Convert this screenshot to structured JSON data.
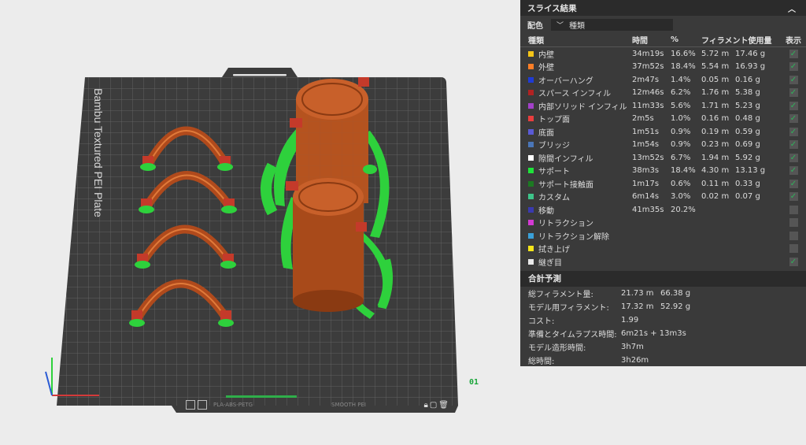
{
  "viewport": {
    "plate_name": "Bambu Textured PEI Plate",
    "plate_number": "01",
    "filament_label": "PLA-ABS-PETG",
    "plate_badge": "SMOOTH PEI"
  },
  "panel": {
    "title": "スライス結果",
    "color_scheme_label": "配色",
    "color_scheme_value": "種類",
    "columns": [
      "種類",
      "時間",
      "%",
      "フィラメント使用量",
      "表示"
    ],
    "rows": [
      {
        "name": "内壁",
        "color": "#f5c518",
        "time": "34m19s",
        "pct": "16.6%",
        "len": "5.72 m",
        "weight": "17.46 g",
        "shown": true
      },
      {
        "name": "外壁",
        "color": "#ff7f27",
        "time": "37m52s",
        "pct": "18.4%",
        "len": "5.54 m",
        "weight": "16.93 g",
        "shown": true
      },
      {
        "name": "オーバーハング",
        "color": "#1f3bd6",
        "time": "2m47s",
        "pct": "1.4%",
        "len": "0.05 m",
        "weight": "0.16 g",
        "shown": true
      },
      {
        "name": "スパース インフィル",
        "color": "#b22222",
        "time": "12m46s",
        "pct": "6.2%",
        "len": "1.76 m",
        "weight": "5.38 g",
        "shown": true
      },
      {
        "name": "内部ソリッド インフィル",
        "color": "#a341c9",
        "time": "11m33s",
        "pct": "5.6%",
        "len": "1.71 m",
        "weight": "5.23 g",
        "shown": true
      },
      {
        "name": "トップ面",
        "color": "#e83e3e",
        "time": "2m5s",
        "pct": "1.0%",
        "len": "0.16 m",
        "weight": "0.48 g",
        "shown": true
      },
      {
        "name": "底面",
        "color": "#5a5ad6",
        "time": "1m51s",
        "pct": "0.9%",
        "len": "0.19 m",
        "weight": "0.59 g",
        "shown": true
      },
      {
        "name": "ブリッジ",
        "color": "#4a76b8",
        "time": "1m54s",
        "pct": "0.9%",
        "len": "0.23 m",
        "weight": "0.69 g",
        "shown": true
      },
      {
        "name": "隙間インフィル",
        "color": "#ffffff",
        "time": "13m52s",
        "pct": "6.7%",
        "len": "1.94 m",
        "weight": "5.92 g",
        "shown": true
      },
      {
        "name": "サポート",
        "color": "#1ee33a",
        "time": "38m3s",
        "pct": "18.4%",
        "len": "4.30 m",
        "weight": "13.13 g",
        "shown": true
      },
      {
        "name": "サポート接触面",
        "color": "#1c7a22",
        "time": "1m17s",
        "pct": "0.6%",
        "len": "0.11 m",
        "weight": "0.33 g",
        "shown": true
      },
      {
        "name": "カスタム",
        "color": "#3ec48a",
        "time": "6m14s",
        "pct": "3.0%",
        "len": "0.02 m",
        "weight": "0.07 g",
        "shown": true
      },
      {
        "name": "移動",
        "color": "#3a3ab0",
        "time": "41m35s",
        "pct": "20.2%",
        "len": "",
        "weight": "",
        "shown": false
      },
      {
        "name": "リトラクション",
        "color": "#d43ad4",
        "time": "",
        "pct": "",
        "len": "",
        "weight": "",
        "shown": false
      },
      {
        "name": "リトラクション解除",
        "color": "#3aa0d8",
        "time": "",
        "pct": "",
        "len": "",
        "weight": "",
        "shown": false
      },
      {
        "name": "拭き上げ",
        "color": "#f5e51a",
        "time": "",
        "pct": "",
        "len": "",
        "weight": "",
        "shown": false
      },
      {
        "name": "継ぎ目",
        "color": "#e8e8e8",
        "time": "",
        "pct": "",
        "len": "",
        "weight": "",
        "shown": true
      }
    ],
    "totals_title": "合計予測",
    "totals": [
      {
        "label": "総フィラメント量:",
        "v1": "21.73 m",
        "v2": "66.38 g"
      },
      {
        "label": "モデル用フィラメント:",
        "v1": "17.32 m",
        "v2": "52.92 g"
      },
      {
        "label": "コスト:",
        "v1": "1.99",
        "v2": ""
      },
      {
        "label": "準備とタイムラプス時間:",
        "v1": "6m21s + 13m3s",
        "v2": ""
      },
      {
        "label": "モデル造形時間:",
        "v1": "3h7m",
        "v2": ""
      },
      {
        "label": "総時間:",
        "v1": "3h26m",
        "v2": ""
      }
    ]
  }
}
